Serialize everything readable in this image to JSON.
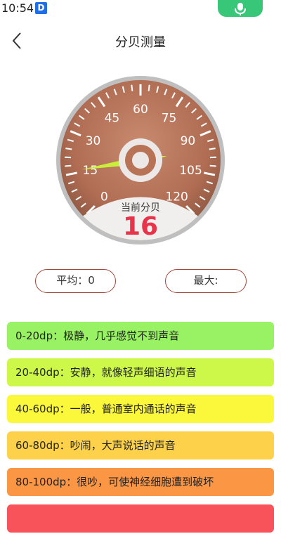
{
  "status_bar": {
    "time": "10:54",
    "app_badge": "D",
    "mic_icon": "microphone-icon"
  },
  "header": {
    "title": "分贝测量",
    "back_icon": "chevron-left-icon"
  },
  "gauge": {
    "ticks": [
      "0",
      "15",
      "30",
      "45",
      "60",
      "75",
      "90",
      "105",
      "120"
    ],
    "min": 0,
    "max": 120,
    "current_label": "当前分贝",
    "current_value": "16",
    "needle_value": 16,
    "colors": {
      "face": "#b5755a",
      "needle": "#c8f03a",
      "value": "#e8334a"
    }
  },
  "stats": {
    "average": "平均：0",
    "max": "最大:"
  },
  "ranges": [
    {
      "text": "0-20dp：极静，几乎感觉不到声音",
      "color": "#99f263"
    },
    {
      "text": "20-40dp：安静，就像轻声细语的声音",
      "color": "#cdf84a"
    },
    {
      "text": "40-60dp：一般，普通室内通话的声音",
      "color": "#fbf73a"
    },
    {
      "text": "60-80dp：吵闹，大声说话的声音",
      "color": "#fdd24a"
    },
    {
      "text": "80-100dp：很吵，可使神经细胞遭到破坏",
      "color": "#fb9645"
    },
    {
      "text": "",
      "color": "#f8525a"
    }
  ]
}
